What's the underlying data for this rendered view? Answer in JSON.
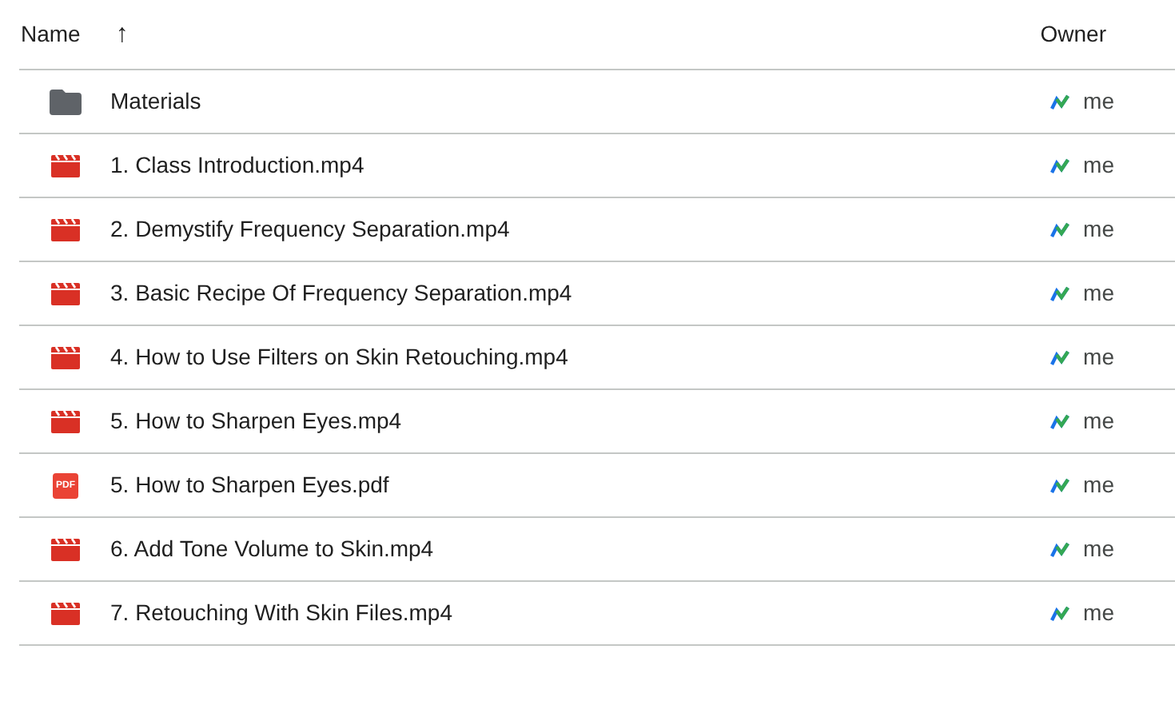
{
  "columns": {
    "name": "Name",
    "sort_icon": "↑",
    "owner": "Owner"
  },
  "rows": [
    {
      "kind": "folder",
      "name": "Materials",
      "owner": "me"
    },
    {
      "kind": "video",
      "name": "1. Class Introduction.mp4",
      "owner": "me"
    },
    {
      "kind": "video",
      "name": "2. Demystify Frequency Separation.mp4",
      "owner": "me"
    },
    {
      "kind": "video",
      "name": "3. Basic Recipe Of Frequency Separation.mp4",
      "owner": "me"
    },
    {
      "kind": "video",
      "name": "4. How to Use Filters on Skin Retouching.mp4",
      "owner": "me"
    },
    {
      "kind": "video",
      "name": "5. How to Sharpen Eyes.mp4",
      "owner": "me"
    },
    {
      "kind": "pdf",
      "icon_label": "PDF",
      "name": "5. How to Sharpen Eyes.pdf",
      "owner": "me"
    },
    {
      "kind": "video",
      "name": "6. Add Tone Volume to Skin.mp4",
      "owner": "me"
    },
    {
      "kind": "video",
      "name": "7. Retouching With Skin Files.mp4",
      "owner": "me"
    }
  ]
}
